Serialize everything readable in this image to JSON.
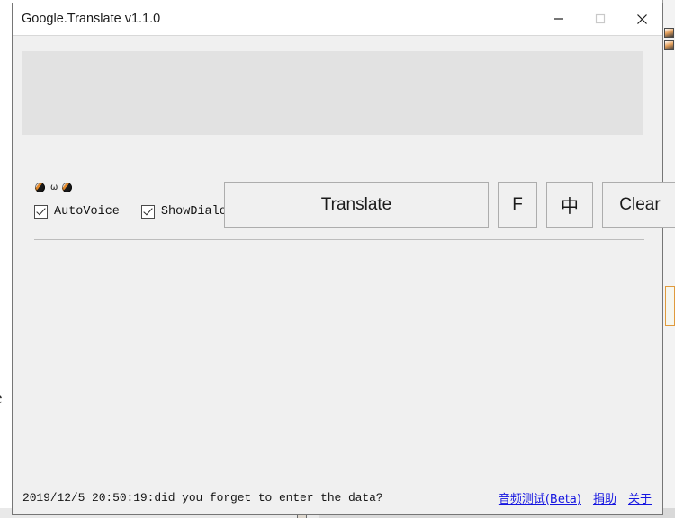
{
  "window": {
    "title": "Google.Translate v1.1.0",
    "controls": {
      "minimize": "minimize-icon",
      "maximize": "maximize-icon",
      "close": "close-icon"
    }
  },
  "main": {
    "input": {
      "value": "",
      "placeholder": ""
    },
    "audio_indicators": [
      {
        "icon": "speaker-icon"
      },
      {
        "icon": "sound-wave-icon"
      },
      {
        "icon": "speaker-icon"
      }
    ],
    "checkboxes": [
      {
        "label": "AutoVoice",
        "checked": true
      },
      {
        "label": "ShowDialog",
        "checked": true
      }
    ],
    "buttons": [
      {
        "id": "translate",
        "label": "Translate"
      },
      {
        "id": "f",
        "label": "F"
      },
      {
        "id": "zh",
        "label": "中"
      },
      {
        "id": "clear",
        "label": "Clear"
      }
    ]
  },
  "status_bar": {
    "message": "2019/12/5 20:50:19:did you forget to enter the data?",
    "links": [
      {
        "label": "音频测试(Beta)"
      },
      {
        "label": "捐助"
      },
      {
        "label": "关于"
      }
    ]
  },
  "background": {
    "left_text": "e",
    "colors": {
      "window_bg": "#f0f0f0",
      "textarea_bg": "#e2e2e2",
      "link": "#1414e0",
      "button_border": "#adadad",
      "accent_orange": "#e09a3c"
    }
  }
}
